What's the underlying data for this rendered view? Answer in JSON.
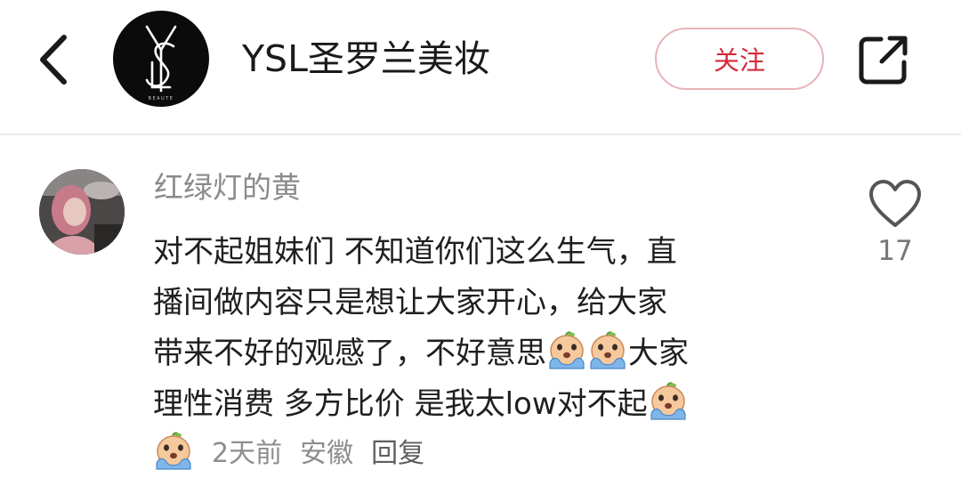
{
  "header": {
    "brand_name": "YSL圣罗兰美妆",
    "follow_label": "关注",
    "logo_monogram": "YSL",
    "logo_subtext": "BEAUTE",
    "icons": {
      "back": "chevron-left-icon",
      "share": "share-external-icon"
    }
  },
  "comment": {
    "username": "红绿灯的黄",
    "lines": [
      "对不起姐妹们 不知道你们这么生气，直",
      "播间做内容只是想让大家开心，给大家",
      "带来不好的观感了，不好意思",
      "大家",
      "理性消费 多方比价 是我太low对不起"
    ],
    "time": "2天前",
    "location": "安徽",
    "reply_label": "回复",
    "like_count": "17",
    "emoji_name": "crying-emoji-icon"
  },
  "colors": {
    "accent_red": "#d42a3a",
    "follow_border": "#e7b3b8",
    "muted_text": "#8a8a8a",
    "divider": "#ececec"
  }
}
